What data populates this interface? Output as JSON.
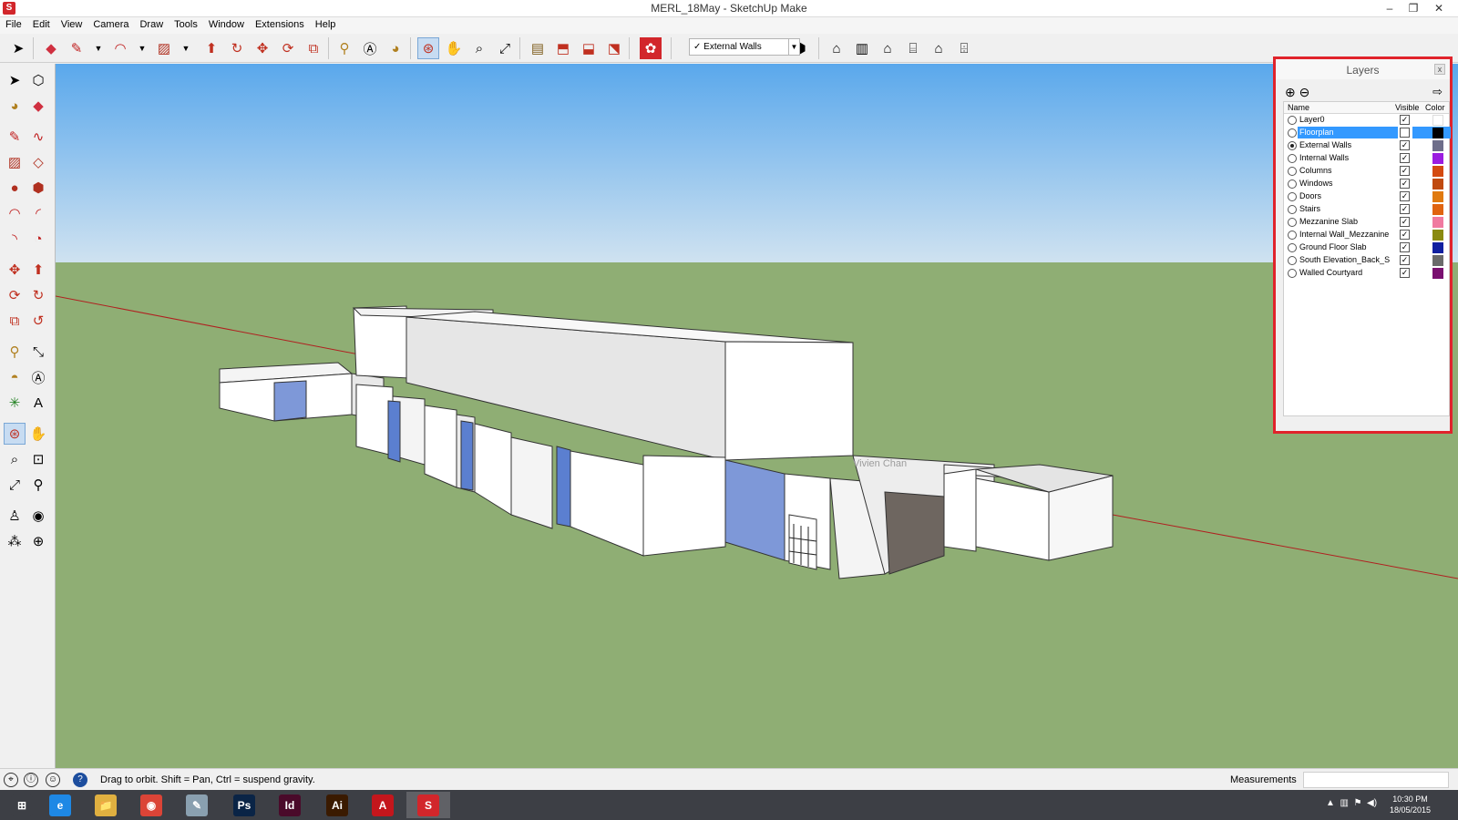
{
  "window": {
    "title": "MERL_18May - SketchUp Make",
    "minimize": "–",
    "restore": "❐",
    "close": "✕"
  },
  "menu": [
    "File",
    "Edit",
    "View",
    "Camera",
    "Draw",
    "Tools",
    "Window",
    "Extensions",
    "Help"
  ],
  "toolbar": {
    "layer_dropdown": "External Walls"
  },
  "viewport": {
    "watermark": "Vivien Chan"
  },
  "layers_panel": {
    "title": "Layers",
    "close": "x",
    "add": "⊕",
    "remove": "⊖",
    "details": "⇨",
    "columns": {
      "name": "Name",
      "visible": "Visible",
      "color": "Color"
    },
    "rows": [
      {
        "name": "Layer0",
        "visible": true,
        "active": false,
        "selected": false,
        "color": "#ffffff"
      },
      {
        "name": "Floorplan",
        "visible": false,
        "active": false,
        "selected": true,
        "color": "#000000"
      },
      {
        "name": "External Walls",
        "visible": true,
        "active": true,
        "selected": false,
        "color": "#6e6e8a"
      },
      {
        "name": "Internal Walls",
        "visible": true,
        "active": false,
        "selected": false,
        "color": "#9b1de0"
      },
      {
        "name": "Columns",
        "visible": true,
        "active": false,
        "selected": false,
        "color": "#d44a10"
      },
      {
        "name": "Windows",
        "visible": true,
        "active": false,
        "selected": false,
        "color": "#c04a10"
      },
      {
        "name": "Doors",
        "visible": true,
        "active": false,
        "selected": false,
        "color": "#e07a10"
      },
      {
        "name": "Stairs",
        "visible": true,
        "active": false,
        "selected": false,
        "color": "#e06410"
      },
      {
        "name": "Mezzanine Slab",
        "visible": true,
        "active": false,
        "selected": false,
        "color": "#f07aa0"
      },
      {
        "name": "Internal Wall_Mezzanine",
        "visible": true,
        "active": false,
        "selected": false,
        "color": "#8a8a10"
      },
      {
        "name": "Ground Floor Slab",
        "visible": true,
        "active": false,
        "selected": false,
        "color": "#1020a0"
      },
      {
        "name": "South Elevation_Back_S",
        "visible": true,
        "active": false,
        "selected": false,
        "color": "#6a6a6a"
      },
      {
        "name": "Walled Courtyard",
        "visible": true,
        "active": false,
        "selected": false,
        "color": "#7a1070"
      }
    ]
  },
  "status": {
    "message": "Drag to orbit. Shift = Pan, Ctrl = suspend gravity.",
    "measurements_label": "Measurements",
    "measurements_value": ""
  },
  "taskbar": {
    "time": "10:30 PM",
    "date": "18/05/2015",
    "apps": [
      {
        "name": "Start",
        "label": "⊞",
        "color": "#3d3f45"
      },
      {
        "name": "Internet Explorer",
        "label": "e",
        "color": "#1e88e5"
      },
      {
        "name": "File Explorer",
        "label": "📁",
        "color": "#e0b040"
      },
      {
        "name": "Chrome",
        "label": "◉",
        "color": "#db4437"
      },
      {
        "name": "Paint",
        "label": "✎",
        "color": "#8aa0b0"
      },
      {
        "name": "Photoshop",
        "label": "Ps",
        "color": "#0a2446"
      },
      {
        "name": "InDesign",
        "label": "Id",
        "color": "#4a0a2a"
      },
      {
        "name": "Illustrator",
        "label": "Ai",
        "color": "#3a1a00"
      },
      {
        "name": "Acrobat",
        "label": "A",
        "color": "#c4161c"
      },
      {
        "name": "SketchUp",
        "label": "S",
        "color": "#d2262b"
      }
    ]
  },
  "colors": {
    "sky_top": "#5aa8ec",
    "sky_bottom": "#c8def0",
    "ground": "#8fae74",
    "accent": "#3399ff",
    "highlight": "#e0232b"
  }
}
